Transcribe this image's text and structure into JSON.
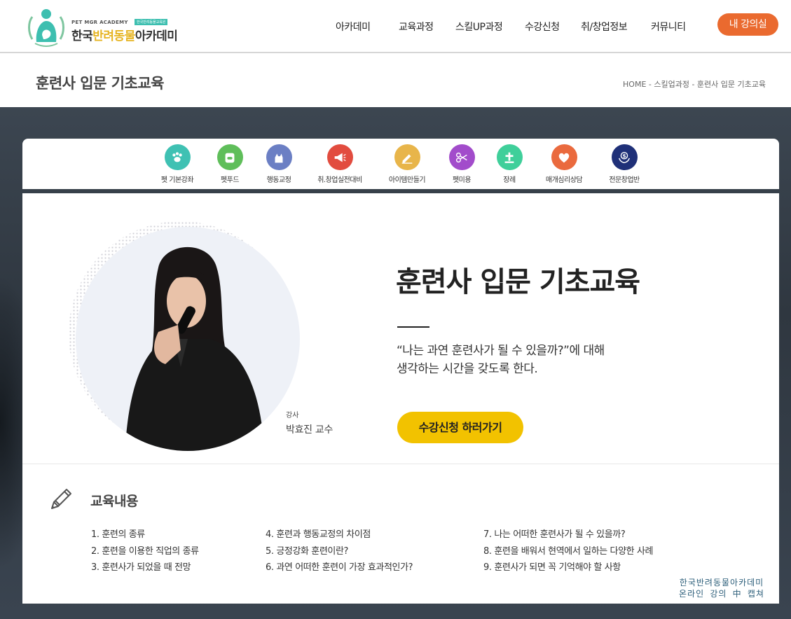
{
  "logo": {
    "sub": "PET MGR ACADEMY",
    "tag": "한국반려동물교육원",
    "name_part1": "한국",
    "name_highlight": "반려동물",
    "name_part2": "아카데미"
  },
  "nav": {
    "items": [
      "아카데미",
      "교육과정",
      "스킬UP과정",
      "수강신청",
      "취/창업정보",
      "커뮤니티"
    ],
    "my_course_label": "내 강의실"
  },
  "title_bar": {
    "title": "훈련사 입문 기초교육",
    "breadcrumb": "HOME - 스킬업과정 - 훈련사 입문 기초교육"
  },
  "categories": [
    {
      "label": "펫 기본강좌",
      "icon": "paw-icon",
      "color": "#3fc1b3"
    },
    {
      "label": "펫푸드",
      "icon": "dog-food-icon",
      "color": "#5fbe5a"
    },
    {
      "label": "행동교정",
      "icon": "dog-icon",
      "color": "#6b7fc4"
    },
    {
      "label": "취.창업실전대비",
      "icon": "megaphone-icon",
      "color": "#e24c3f"
    },
    {
      "label": "아이템만들기",
      "icon": "pencil-icon",
      "color": "#e8b54a"
    },
    {
      "label": "펫미용",
      "icon": "scissors-icon",
      "color": "#a24ccb"
    },
    {
      "label": "장례",
      "icon": "cross-icon",
      "color": "#3fcf9a"
    },
    {
      "label": "매개심리상담",
      "icon": "heart-icon",
      "color": "#ea6a3e"
    },
    {
      "label": "전문창업반",
      "icon": "dollar-hands-icon",
      "color": "#1f3078"
    }
  ],
  "course": {
    "title": "훈련사 입문 기초교육",
    "desc_line1": "“나는 과연 훈련사가 될 수 있을까?”에 대해",
    "desc_line2": "생각하는 시간을 갖도록 한다.",
    "apply_label": "수강신청 하러가기",
    "instructor_role": "강사",
    "instructor_name": "박효진 교수"
  },
  "curriculum": {
    "heading": "교육내용",
    "columns": [
      [
        "1. 훈련의 종류",
        "2. 훈련을 이용한 직업의 종류",
        "3. 훈련사가 되었을 때 전망"
      ],
      [
        "4. 훈련과 행동교정의 차이점",
        "5. 긍정강화 훈련이란?",
        "6. 과연 어떠한 훈련이 가장 효과적인가?"
      ],
      [
        "7. 나는 어떠한 훈련사가 될 수 있을까?",
        "8. 훈련을 배워서 현역에서 일하는 다양한 사례",
        "9. 훈련사가 되면 꼭 기억해야 할 사항"
      ]
    ]
  },
  "watermark": {
    "line1": "한국반려동물아카데미",
    "line2": "온라인 강의 中 캡쳐"
  },
  "colors": {
    "accent_orange": "#ea6a2f",
    "apply_yellow": "#f2c200",
    "logo_teal": "#3dbfb0"
  }
}
